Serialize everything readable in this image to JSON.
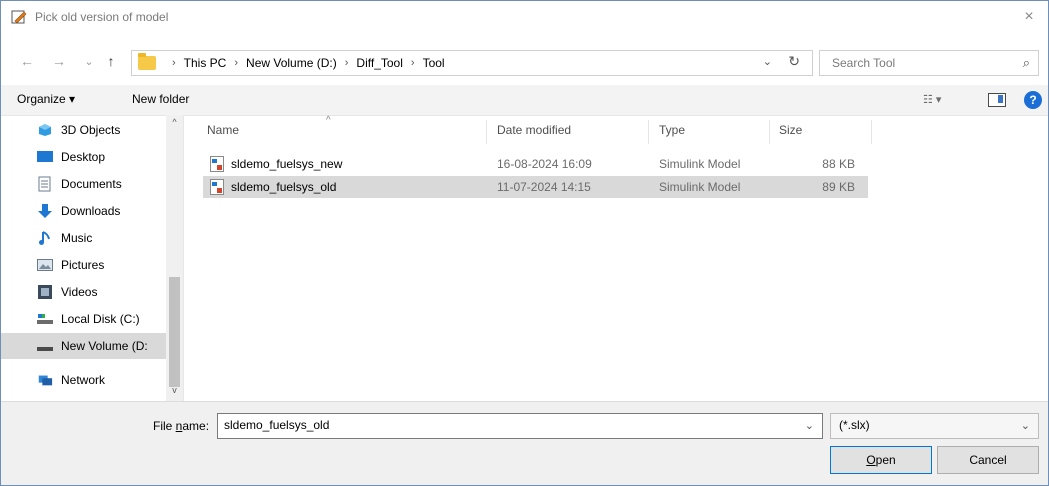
{
  "window": {
    "title": "Pick old version of model",
    "close_glyph": "×"
  },
  "nav": {
    "back": "←",
    "forward": "→",
    "recent": "⌄",
    "up": "↑"
  },
  "address": {
    "crumbs": [
      "This PC",
      "New Volume (D:)",
      "Diff_Tool",
      "Tool"
    ],
    "separator": "›",
    "dropdown_glyph": "⌄",
    "refresh_glyph": "↻"
  },
  "search": {
    "placeholder": "Search Tool",
    "icon": "⌕"
  },
  "toolbar": {
    "organize": "Organize ▾",
    "new_folder": "New folder",
    "view_glyph": "☷ ▾",
    "help": "?"
  },
  "sidebar": {
    "items": [
      {
        "label": "3D Objects",
        "icon": "cube-icon",
        "selected": false
      },
      {
        "label": "Desktop",
        "icon": "desktop-icon",
        "selected": false
      },
      {
        "label": "Documents",
        "icon": "documents-icon",
        "selected": false
      },
      {
        "label": "Downloads",
        "icon": "download-icon",
        "selected": false
      },
      {
        "label": "Music",
        "icon": "music-icon",
        "selected": false
      },
      {
        "label": "Pictures",
        "icon": "pictures-icon",
        "selected": false
      },
      {
        "label": "Videos",
        "icon": "video-icon",
        "selected": false
      },
      {
        "label": "Local Disk (C:)",
        "icon": "drive-icon",
        "selected": false
      },
      {
        "label": "New Volume (D:",
        "icon": "drive-icon",
        "selected": true
      },
      {
        "label": "Network",
        "icon": "network-icon",
        "selected": false
      }
    ],
    "scroll_up": "^",
    "scroll_down": "v"
  },
  "files": {
    "columns": {
      "name": "Name",
      "date": "Date modified",
      "type": "Type",
      "size": "Size",
      "sort": "^"
    },
    "rows": [
      {
        "name": "sldemo_fuelsys_new",
        "date": "16-08-2024 16:09",
        "type": "Simulink Model",
        "size": "88 KB",
        "selected": false
      },
      {
        "name": "sldemo_fuelsys_old",
        "date": "11-07-2024 14:15",
        "type": "Simulink Model",
        "size": "89 KB",
        "selected": true
      }
    ]
  },
  "bottom": {
    "file_name_label_pre": "File ",
    "file_name_label_u": "n",
    "file_name_label_post": "ame:",
    "file_name_value": "sldemo_fuelsys_old",
    "filter_value": "(*.slx)",
    "dropdown_glyph": "⌄",
    "open_u": "O",
    "open_rest": "pen",
    "cancel": "Cancel"
  },
  "colors": {
    "accent": "#0078d7",
    "selection": "#d9d9d9",
    "folder": "#f7c948",
    "help": "#1b6ed6"
  }
}
